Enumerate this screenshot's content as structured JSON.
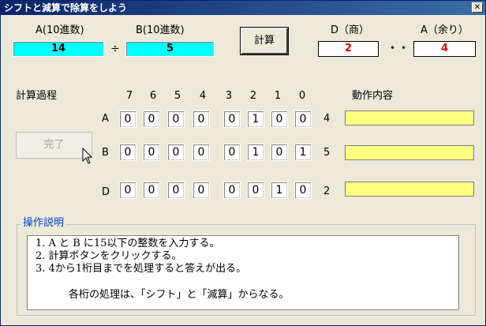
{
  "window": {
    "title": "シフトと減算で除算をしよう",
    "close_glyph": "✕"
  },
  "inputs": {
    "a_label": "A(10進数)",
    "a_value": "14",
    "divide_symbol": "÷",
    "b_label": "B(10進数)",
    "b_value": "5"
  },
  "buttons": {
    "calc": "計算",
    "done": "完了"
  },
  "outputs": {
    "d_label": "D（商）",
    "d_value": "2",
    "dots": "・・・",
    "a_label": "A（余り）",
    "a_value": "4"
  },
  "process": {
    "title": "計算過程",
    "action_header": "動作内容",
    "bit_headers": [
      "7",
      "6",
      "5",
      "4",
      "3",
      "2",
      "1",
      "0"
    ],
    "rows": [
      {
        "name": "A",
        "bits": [
          "0",
          "0",
          "0",
          "0",
          "0",
          "1",
          "0",
          "0"
        ],
        "decimal": "4"
      },
      {
        "name": "B",
        "bits": [
          "0",
          "0",
          "0",
          "0",
          "0",
          "1",
          "0",
          "1"
        ],
        "decimal": "5"
      },
      {
        "name": "D",
        "bits": [
          "0",
          "0",
          "0",
          "0",
          "0",
          "0",
          "1",
          "0"
        ],
        "decimal": "2"
      }
    ]
  },
  "instructions": {
    "title": "操作説明",
    "lines": [
      "1. A と B に15以下の整数を入力する。",
      "2. 計算ボタンをクリックする。",
      "3. 4から1桁目までを処理すると答えが出る。",
      "各桁の処理は、「シフト」と「減算」からなる。"
    ]
  },
  "colors": {
    "input_bg": "#00ffff",
    "result_text": "#e00000",
    "action_bg": "#ffff80",
    "legend": "#0046d5"
  }
}
